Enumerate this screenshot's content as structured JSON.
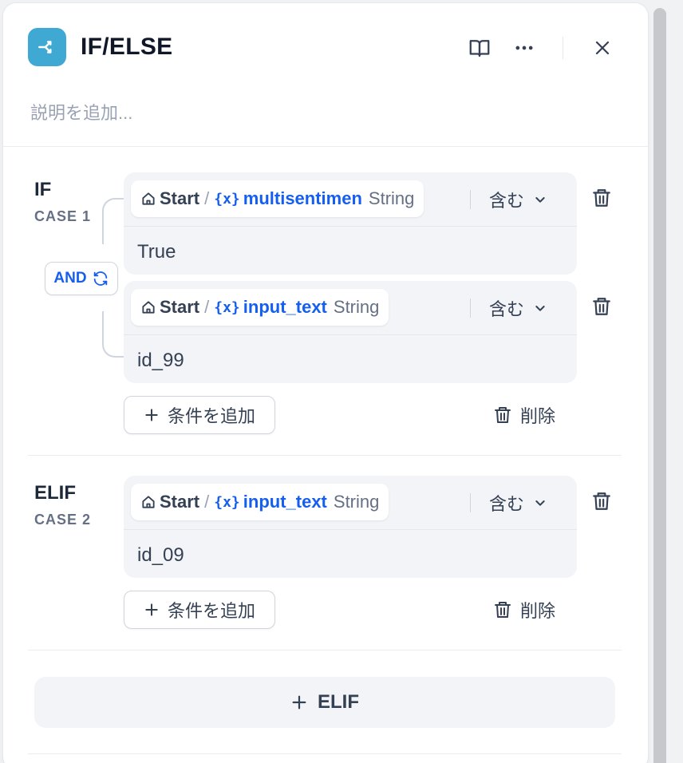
{
  "header": {
    "title": "IF/ELSE",
    "description_placeholder": "説明を追加..."
  },
  "cases": [
    {
      "label": "IF",
      "sub": "CASE 1",
      "logic": "AND",
      "conditions": [
        {
          "node": "Start",
          "var_prefix": "{x}",
          "var": "multisentimen",
          "type": "String",
          "operator": "含む",
          "value": "True"
        },
        {
          "node": "Start",
          "var_prefix": "{x}",
          "var": "input_text",
          "type": "String",
          "operator": "含む",
          "value": "id_99"
        }
      ],
      "add_condition": "条件を追加",
      "remove": "削除"
    },
    {
      "label": "ELIF",
      "sub": "CASE 2",
      "conditions": [
        {
          "node": "Start",
          "var_prefix": "{x}",
          "var": "input_text",
          "type": "String",
          "operator": "含む",
          "value": "id_09"
        }
      ],
      "add_condition": "条件を追加",
      "remove": "削除"
    }
  ],
  "add_elif": "ELIF",
  "colors": {
    "accent": "#155eef",
    "node_icon": "#3fa9d3"
  }
}
